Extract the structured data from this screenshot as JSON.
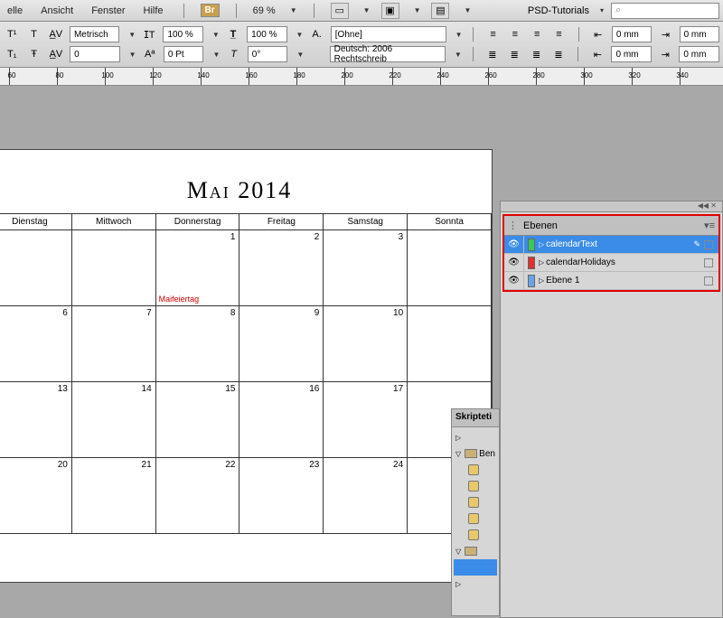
{
  "menu": {
    "items": [
      "elle",
      "Ansicht",
      "Fenster",
      "Hilfe"
    ],
    "zoom": "69 %",
    "psd": "PSD-Tutorials"
  },
  "toolbar": {
    "metrisch": "Metrisch",
    "horiz1": "100 %",
    "horiz2": "100 %",
    "ohne": "[Ohne]",
    "zero": "0",
    "pt": "0 Pt",
    "deg": "0°",
    "lang": "Deutsch: 2006 Rechtschreib",
    "mm": "0 mm"
  },
  "ruler_ticks": [
    60,
    80,
    100,
    120,
    140,
    160,
    180,
    200,
    220,
    240,
    260,
    280,
    300,
    320,
    340
  ],
  "calendar": {
    "title": "Mai 2014",
    "headers": [
      "Dienstag",
      "Mittwoch",
      "Donnerstag",
      "Freitag",
      "Samstag",
      "Sonnta"
    ],
    "rows": [
      [
        {
          "n": ""
        },
        {
          "n": ""
        },
        {
          "n": "1",
          "h": "Maifeiertag"
        },
        {
          "n": "2"
        },
        {
          "n": "3"
        },
        {
          "n": ""
        }
      ],
      [
        {
          "n": "6"
        },
        {
          "n": "7"
        },
        {
          "n": "8"
        },
        {
          "n": "9"
        },
        {
          "n": "10"
        },
        {
          "n": ""
        }
      ],
      [
        {
          "n": "13"
        },
        {
          "n": "14"
        },
        {
          "n": "15"
        },
        {
          "n": "16"
        },
        {
          "n": "17"
        },
        {
          "n": ""
        }
      ],
      [
        {
          "n": "20"
        },
        {
          "n": "21"
        },
        {
          "n": "22"
        },
        {
          "n": "23"
        },
        {
          "n": "24"
        },
        {
          "n": ""
        }
      ]
    ]
  },
  "scripts": {
    "tab": "Skripteti",
    "folder": "Ben"
  },
  "layers": {
    "tab": "Ebenen",
    "items": [
      {
        "name": "calendarText",
        "color": "#3ac85a",
        "selected": true,
        "pen": true
      },
      {
        "name": "calendarHolidays",
        "color": "#e03030",
        "selected": false,
        "pen": false
      },
      {
        "name": "Ebene 1",
        "color": "#6aa2e8",
        "selected": false,
        "pen": false
      }
    ]
  }
}
